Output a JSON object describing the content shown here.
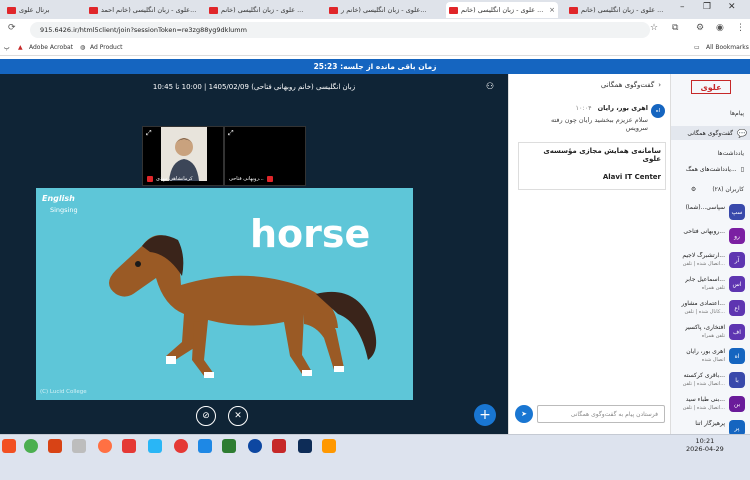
{
  "tabs": [
    {
      "label": "برنال علوی",
      "active": false
    },
    {
      "label": "علوی - زبان انگلیسی (خانم احمد...",
      "active": false
    },
    {
      "label": "علوی - زبان انگلیسی (خانم ...",
      "active": false
    },
    {
      "label": "علوی - زبان انگلیسی (خانم ر...",
      "active": false
    },
    {
      "label": "علوی - زبان انگلیسی (خانم ...",
      "active": true
    },
    {
      "label": "علوی - زبان انگلیسی (خانم ...",
      "active": false
    }
  ],
  "address": {
    "url": "915.6426.ir/html5client/join?sessionToken=re3zg88yg9dklumm"
  },
  "bookmarks": {
    "left": [
      "Adobe Acrobat",
      "Ad Product"
    ],
    "right": "All Bookmarks"
  },
  "session": {
    "remaining": "زمان باقی مانده از جلسه: 25:23"
  },
  "stage": {
    "title": "زبان انگلیسی (خانم روبهانی فتاحی) 1405/02/09 | 10:00 تا 10:45"
  },
  "cameras": [
    {
      "label": "روبهانی فتاحی..."
    },
    {
      "label": "کرمانشاهی مهدی"
    }
  ],
  "slide": {
    "word": "horse",
    "brand": "English",
    "brand_sub": "Singsing",
    "copyright": "(C) Lucid College"
  },
  "chat": {
    "header": "گفت‌وگوی همگانی",
    "sender": "اهری بور، رایان",
    "time": "۱۰:۰۴",
    "message": "سلام عزیزم ببخشید رایان چون رفته سرویس",
    "notice_title": "سامانه‌ی همایش مجازی مؤسسه‌ی علوی",
    "notice_sub": "Alavi IT Center",
    "input_placeholder": "فرستادن پیام به گفت‌وگوی همگانی"
  },
  "side": {
    "logo": "علوی",
    "messages_heading": "پیام‌ها",
    "public_chat": "گفت‌وگوی همگانی",
    "notes_heading": "یادداشت‌ها",
    "shared_notes": "یادداشت‌های همگ...",
    "users_heading": "کاربران (۲۸)",
    "users": [
      {
        "avatar": "سپ",
        "name": "سپاسی...(شما)",
        "status": ""
      },
      {
        "avatar": "رو",
        "name": "روبهانی فتاحی...",
        "status": ""
      },
      {
        "avatar": "آر",
        "name": "آرتشبرگ لاجیم...",
        "status": "اتصال شده | تلفن..."
      },
      {
        "avatar": "اس",
        "name": "اسماعیل جابر...",
        "status": "تلفن همراه"
      },
      {
        "avatar": "اع",
        "name": "اعتمادی مشاور...",
        "status": "کانال شده | تلفن..."
      },
      {
        "avatar": "اف",
        "name": "افتخاری، پاکسیر",
        "status": "تلفن همراه"
      },
      {
        "avatar": "اه",
        "name": "اهری بور، رایان",
        "status": "اتصال شده"
      },
      {
        "avatar": "با",
        "name": "باقری کرکسته...",
        "status": "اتصال شده | تلفن..."
      },
      {
        "avatar": "بن",
        "name": "بنی طباء سید...",
        "status": "اتصال شده | تلفن..."
      },
      {
        "avatar": "پر",
        "name": "پرهیزگار آتنا",
        "status": ""
      }
    ]
  },
  "taskbar": {
    "time": "10:21",
    "date": "2026-04-29"
  }
}
